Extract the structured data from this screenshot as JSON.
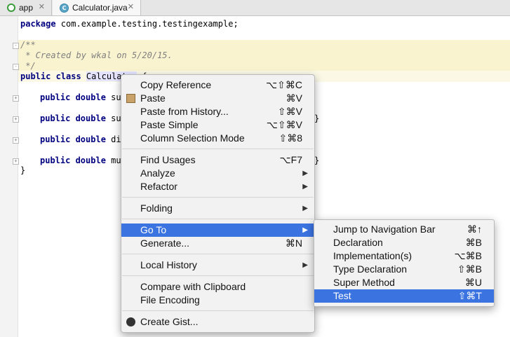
{
  "tabs": [
    {
      "label": "app",
      "icon": "android-module-icon"
    },
    {
      "label": "Calculator.java",
      "icon": "class-c-icon",
      "icon_letter": "C"
    }
  ],
  "editor": {
    "lines": {
      "package_kw": "package",
      "package_name": " com.example.testing.testingexample;",
      "doc_open": "/**",
      "doc_created": " * Created by wkal on 5/20/15.",
      "doc_close": " */",
      "class_kw": "public class ",
      "class_name": "Calculator",
      "class_brace": " {",
      "m1_kw": "public double ",
      "m1_name": "sum",
      "m2_kw": "public double ",
      "m2_name": "sub",
      "m2_tail": "}",
      "m3_kw": "public double ",
      "m3_name": "div",
      "m4_kw": "public double ",
      "m4_name": "mul",
      "m4_tail": "}",
      "close_brace": "}"
    }
  },
  "context_menu": {
    "items": [
      {
        "label": "Copy Reference",
        "shortcut": "⌥⇧⌘C"
      },
      {
        "label": "Paste",
        "shortcut": "⌘V",
        "icon": "paste-icon"
      },
      {
        "label": "Paste from History...",
        "shortcut": "⇧⌘V"
      },
      {
        "label": "Paste Simple",
        "shortcut": "⌥⇧⌘V"
      },
      {
        "label": "Column Selection Mode",
        "shortcut": "⇧⌘8"
      },
      {
        "label": "Find Usages",
        "shortcut": "⌥F7"
      },
      {
        "label": "Analyze",
        "submenu": true
      },
      {
        "label": "Refactor",
        "submenu": true
      },
      {
        "label": "Folding",
        "submenu": true
      },
      {
        "label": "Go To",
        "submenu": true,
        "selected": true
      },
      {
        "label": "Generate...",
        "shortcut": "⌘N"
      },
      {
        "label": "Local History",
        "submenu": true
      },
      {
        "label": "Compare with Clipboard"
      },
      {
        "label": "File Encoding"
      },
      {
        "label": "Create Gist...",
        "icon": "github-icon"
      }
    ],
    "arrow": "▶"
  },
  "goto_submenu": {
    "items": [
      {
        "label": "Jump to Navigation Bar",
        "shortcut": "⌘↑"
      },
      {
        "label": "Declaration",
        "shortcut": "⌘B"
      },
      {
        "label": "Implementation(s)",
        "shortcut": "⌥⌘B"
      },
      {
        "label": "Type Declaration",
        "shortcut": "⇧⌘B"
      },
      {
        "label": "Super Method",
        "shortcut": "⌘U"
      },
      {
        "label": "Test",
        "shortcut": "⇧⌘T",
        "selected": true
      }
    ]
  },
  "colors": {
    "selection": "#3b73e1",
    "keyword": "#000080",
    "comment": "#808080",
    "doc_highlight": "#f9f3cf"
  }
}
